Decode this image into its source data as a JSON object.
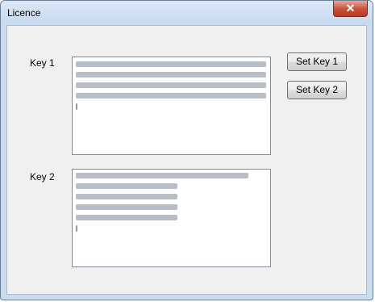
{
  "window": {
    "title": "Licence",
    "close_glyph": "✕"
  },
  "key1": {
    "label": "Key 1",
    "button_label": "Set Key 1"
  },
  "key2": {
    "label": "Key 2",
    "button_label": "Set Key 2"
  }
}
